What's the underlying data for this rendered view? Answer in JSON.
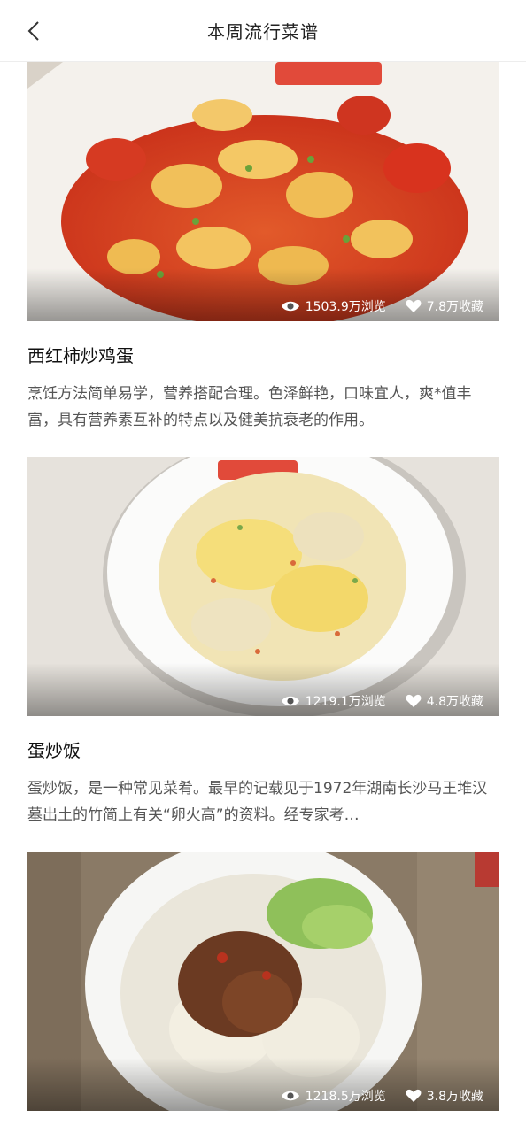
{
  "header": {
    "title": "本周流行菜谱"
  },
  "recipes": [
    {
      "name": "西红柿炒鸡蛋",
      "desc": "烹饪方法简单易学，营养搭配合理。色泽鲜艳，口味宜人，爽*值丰富，具有营养素互补的特点以及健美抗衰老的作用。",
      "views": "1503.9万浏览",
      "favorites": "7.8万收藏"
    },
    {
      "name": "蛋炒饭",
      "desc": "蛋炒饭，是一种常见菜肴。最早的记载见于1972年湖南长沙马王堆汉墓出土的竹简上有关“卵火高”的资料。经专家考…",
      "views": "1219.1万浏览",
      "favorites": "4.8万收藏"
    },
    {
      "views": "1218.5万浏览",
      "favorites": "3.8万收藏"
    }
  ],
  "icons": {
    "back": "chevron-left-icon",
    "views": "eye-icon",
    "favorites": "heart-icon"
  }
}
